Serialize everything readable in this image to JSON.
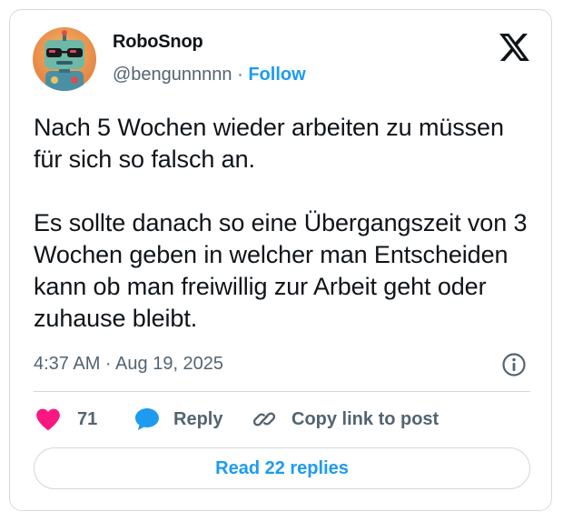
{
  "author": {
    "name": "RoboSnop",
    "handle": "@bengunnnnn",
    "separator": "·",
    "follow_label": "Follow"
  },
  "brand": {
    "logo_icon": "x-logo-icon"
  },
  "tweet": {
    "text": "Nach 5 Wochen wieder arbeiten zu müssen für sich so falsch an.\n\nEs sollte danach so eine Übergangszeit von 3 Wochen geben in welcher man Entscheiden kann ob man freiwillig zur Arbeit geht oder zuhause bleibt.",
    "timestamp": "4:37 AM · Aug 19, 2025",
    "info_icon": "info-icon"
  },
  "actions": {
    "likes_count": "71",
    "like_icon": "heart-icon",
    "reply_label": "Reply",
    "reply_icon": "speech-bubble-icon",
    "copy_label": "Copy link to post",
    "copy_icon": "link-icon"
  },
  "footer": {
    "read_replies_label": "Read 22 replies"
  },
  "colors": {
    "accent": "#1d9bf0",
    "heart": "#f91880",
    "text": "#0f1419",
    "muted": "#536471",
    "border": "#cfd9de"
  }
}
